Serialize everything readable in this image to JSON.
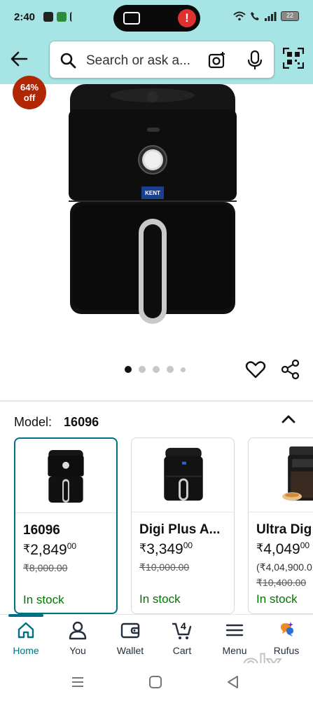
{
  "status_bar": {
    "time": "2:40",
    "battery": "22"
  },
  "search": {
    "placeholder": "Search or ask a..."
  },
  "product": {
    "discount_badge_line1": "64%",
    "discount_badge_line2": "off",
    "brand_on_device": "KENT",
    "carousel_active_index": 0,
    "carousel_count": 5
  },
  "model": {
    "label": "Model:",
    "value": "16096"
  },
  "variants": [
    {
      "name": "16096",
      "price_rupees": "2,849",
      "price_paise": "00",
      "currency": "₹",
      "mrp": "₹8,000.00",
      "stock": "In stock",
      "selected": true
    },
    {
      "name": "Digi Plus A...",
      "price_rupees": "3,349",
      "price_paise": "00",
      "currency": "₹",
      "mrp": "₹10,000.00",
      "stock": "In stock",
      "selected": false
    },
    {
      "name": "Ultra Dig",
      "price_rupees": "4,049",
      "price_paise": "00",
      "currency": "₹",
      "unit_price": "(₹4,04,900.0",
      "mrp": "₹10,400.00",
      "stock": "In stock",
      "selected": false
    }
  ],
  "bottom_nav": {
    "items": [
      {
        "label": "Home",
        "icon": "home-icon",
        "active": true
      },
      {
        "label": "You",
        "icon": "person-icon",
        "active": false
      },
      {
        "label": "Wallet",
        "icon": "wallet-icon",
        "active": false
      },
      {
        "label": "Cart",
        "icon": "cart-icon",
        "active": false,
        "count": "4"
      },
      {
        "label": "Menu",
        "icon": "menu-icon",
        "active": false
      },
      {
        "label": "Rufus",
        "icon": "rufus-icon",
        "active": false
      }
    ]
  },
  "watermark": "olx",
  "colors": {
    "header_bg": "#a6e4e5",
    "accent": "#007185",
    "badge": "#b12704",
    "in_stock": "#007600"
  }
}
